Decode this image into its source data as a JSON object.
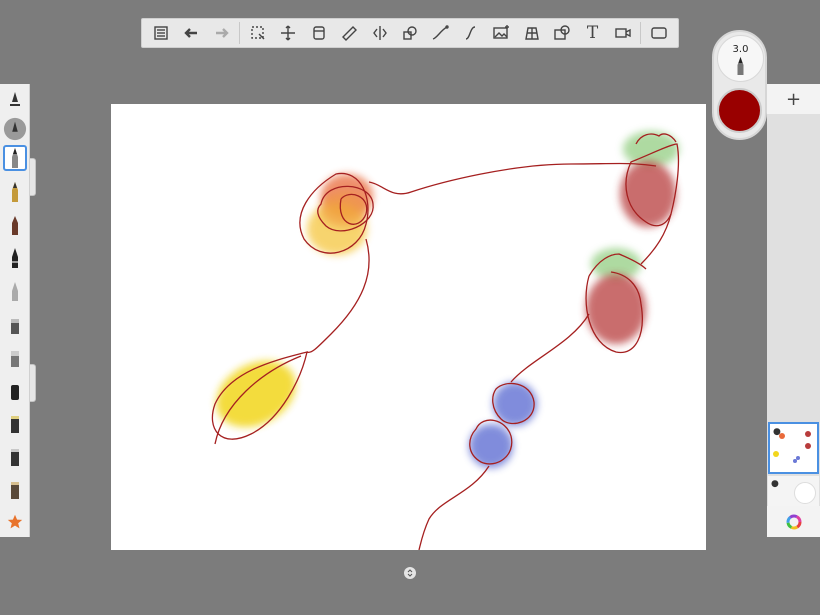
{
  "toolbar": {
    "items": [
      {
        "name": "menu-icon"
      },
      {
        "name": "undo-icon"
      },
      {
        "name": "redo-icon"
      },
      {
        "name": "selection-icon"
      },
      {
        "name": "transform-icon"
      },
      {
        "name": "fill-icon"
      },
      {
        "name": "ruler-icon"
      },
      {
        "name": "symmetry-icon"
      },
      {
        "name": "shapes-icon"
      },
      {
        "name": "curve-icon"
      },
      {
        "name": "stroke-icon"
      },
      {
        "name": "image-import-icon"
      },
      {
        "name": "perspective-icon"
      },
      {
        "name": "timelapse-icon"
      },
      {
        "name": "text-tool"
      },
      {
        "name": "video-icon"
      },
      {
        "name": "fullscreen-icon"
      }
    ],
    "text_label": "T"
  },
  "brush_puck": {
    "size_value": "3.0",
    "color": "#990000"
  },
  "layers": {
    "add_label": "+"
  },
  "brushes": [
    "ink-pen-icon",
    "airbrush-icon",
    "pencil-icon",
    "fountain-pen-icon",
    "marker-icon",
    "ballpoint-icon",
    "technical-pen-icon",
    "paint-brush-icon",
    "wet-brush-icon",
    "charcoal-icon",
    "chalk-icon",
    "flat-brush-icon",
    "eraser-icon",
    "favorites-star-icon"
  ],
  "colors": {
    "accent": "#4a90e2",
    "stroke": "#a52020",
    "background": "#7c7c7c"
  }
}
